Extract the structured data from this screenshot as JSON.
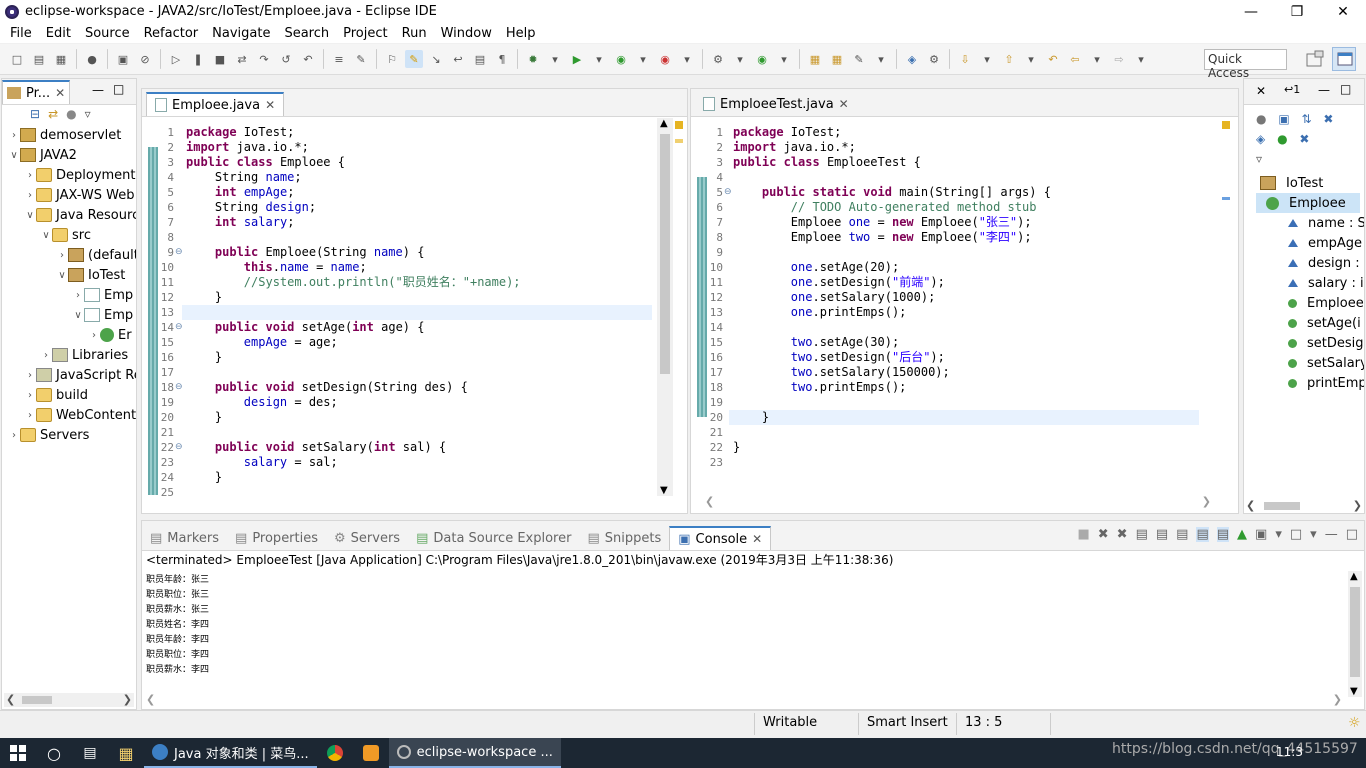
{
  "window": {
    "title": "eclipse-workspace - JAVA2/src/IoTest/Emploee.java - Eclipse IDE"
  },
  "menu": [
    "File",
    "Edit",
    "Source",
    "Refactor",
    "Navigate",
    "Search",
    "Project",
    "Run",
    "Window",
    "Help"
  ],
  "toolbar": {
    "quick_access": "Quick Access"
  },
  "explorer": {
    "tab_label": "Pr...",
    "items": [
      {
        "label": "demoservlet",
        "depth": 0,
        "expand": "collapsed",
        "icon": "project-icon"
      },
      {
        "label": "JAVA2",
        "depth": 0,
        "expand": "expanded",
        "icon": "project-icon"
      },
      {
        "label": "Deployment",
        "depth": 1,
        "expand": "collapsed",
        "icon": "folder-icon"
      },
      {
        "label": "JAX-WS Web",
        "depth": 1,
        "expand": "collapsed",
        "icon": "folder-icon"
      },
      {
        "label": "Java Resourc",
        "depth": 1,
        "expand": "expanded",
        "icon": "folder-icon"
      },
      {
        "label": "src",
        "depth": 2,
        "expand": "expanded",
        "icon": "folder-icon"
      },
      {
        "label": "(default",
        "depth": 3,
        "expand": "collapsed",
        "icon": "package-icon"
      },
      {
        "label": "IoTest",
        "depth": 3,
        "expand": "expanded",
        "icon": "package-icon"
      },
      {
        "label": "Emp",
        "depth": 4,
        "expand": "collapsed",
        "icon": "java-file-icon"
      },
      {
        "label": "Emp",
        "depth": 4,
        "expand": "expanded",
        "icon": "java-file-icon"
      },
      {
        "label": "Er",
        "depth": 5,
        "expand": "collapsed",
        "icon": "class-icon"
      },
      {
        "label": "Libraries",
        "depth": 2,
        "expand": "collapsed",
        "icon": "library-icon"
      },
      {
        "label": "JavaScript Re",
        "depth": 1,
        "expand": "collapsed",
        "icon": "library-icon"
      },
      {
        "label": "build",
        "depth": 1,
        "expand": "collapsed",
        "icon": "folder-icon"
      },
      {
        "label": "WebContent",
        "depth": 1,
        "expand": "collapsed",
        "icon": "folder-icon"
      },
      {
        "label": "Servers",
        "depth": 0,
        "expand": "collapsed",
        "icon": "folder-icon"
      }
    ]
  },
  "editor1": {
    "tab_label": "Emploee.java",
    "lines": [
      "package IoTest;",
      "import java.io.*;",
      "public class Emploee {",
      "    String name;",
      "    int empAge;",
      "    String design;",
      "    int salary;",
      "",
      "    public Emploee(String name) {",
      "        this.name = name;",
      "        //System.out.println(\"职员姓名：\"+name);",
      "    }",
      "",
      "    public void setAge(int age) {",
      "        empAge = age;",
      "    }",
      "",
      "    public void setDesign(String des) {",
      "        design = des;",
      "    }",
      "",
      "    public void setSalary(int sal) {",
      "        salary = sal;",
      "    }",
      ""
    ]
  },
  "editor2": {
    "tab_label": "EmploeeTest.java",
    "lines": [
      "package IoTest;",
      "import java.io.*;",
      "public class EmploeeTest {",
      "",
      "    public static void main(String[] args) {",
      "        // TODO Auto-generated method stub",
      "        Emploee one = new Emploee(\"张三\");",
      "        Emploee two = new Emploee(\"李四\");",
      "",
      "        one.setAge(20);",
      "        one.setDesign(\"前端\");",
      "        one.setSalary(1000);",
      "        one.printEmps();",
      "",
      "        two.setAge(30);",
      "        two.setDesign(\"后台\");",
      "        two.setSalary(150000);",
      "        two.printEmps();",
      "",
      "    }",
      "",
      "}",
      ""
    ]
  },
  "outline": {
    "items": [
      {
        "label": "IoTest",
        "kind": "package-icon"
      },
      {
        "label": "Emploee",
        "kind": "class-icon"
      },
      {
        "label": "name : S",
        "kind": "field-icon"
      },
      {
        "label": "empAge",
        "kind": "field-icon"
      },
      {
        "label": "design :",
        "kind": "field-icon"
      },
      {
        "label": "salary : i",
        "kind": "field-icon"
      },
      {
        "label": "Emploee",
        "kind": "constructor-icon"
      },
      {
        "label": "setAge(i",
        "kind": "method-icon"
      },
      {
        "label": "setDesig",
        "kind": "method-icon"
      },
      {
        "label": "setSalary",
        "kind": "method-icon"
      },
      {
        "label": "printEmp",
        "kind": "method-icon"
      }
    ]
  },
  "bottom_tabs": [
    "Markers",
    "Properties",
    "Servers",
    "Data Source Explorer",
    "Snippets",
    "Console"
  ],
  "console": {
    "header": "<terminated> EmploeeTest [Java Application] C:\\Program Files\\Java\\jre1.8.0_201\\bin\\javaw.exe (2019年3月3日 上午11:38:36)",
    "lines": [
      "职员年龄：张三",
      "职员职位：张三",
      "职员薪水：张三",
      "职员姓名：李四",
      "职员年龄：李四",
      "职员职位：李四",
      "职员薪水：李四"
    ]
  },
  "status": {
    "writable": "Writable",
    "insert_mode": "Smart Insert",
    "position": "13 : 5"
  },
  "taskbar": {
    "items": [
      "Java 对象和类 | 菜鸟...",
      "eclipse-workspace ..."
    ],
    "tray": "https://blog.csdn.net/qq_44515597",
    "clock": "11:3"
  }
}
